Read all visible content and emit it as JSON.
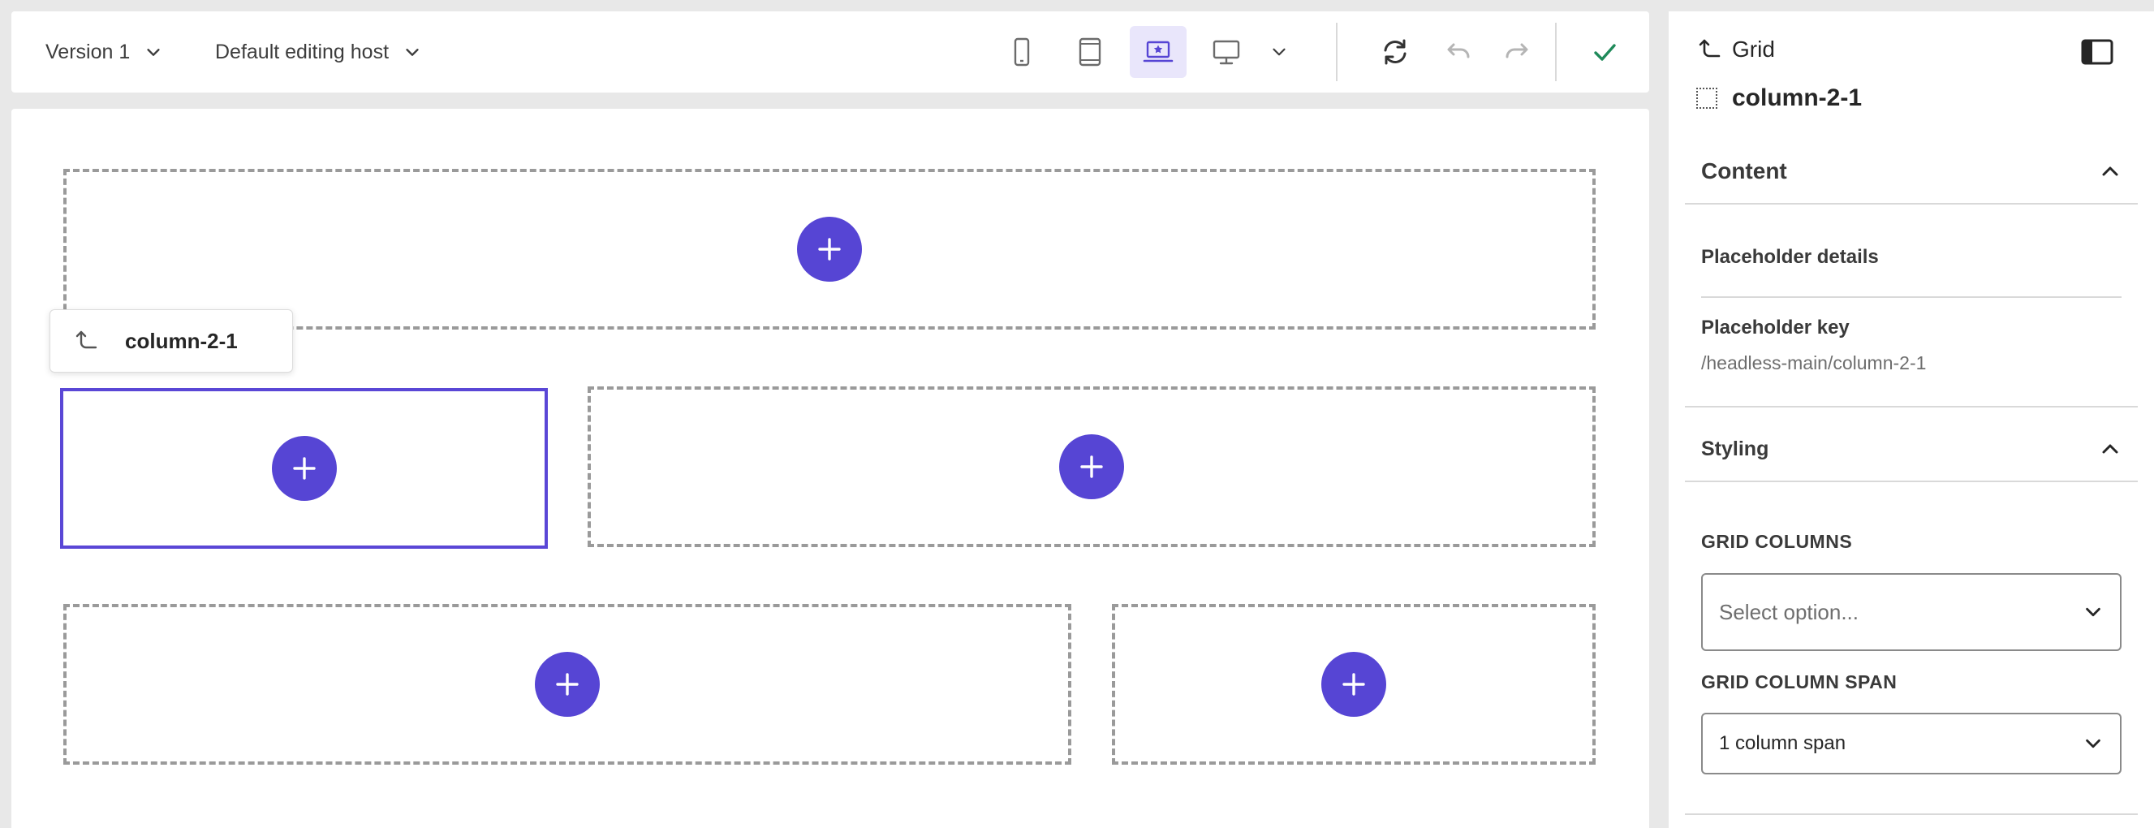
{
  "toolbar": {
    "version_label": "Version 1",
    "host_label": "Default editing host"
  },
  "canvas": {
    "chip_label": "column-2-1"
  },
  "panel": {
    "back_label": "Grid",
    "component_name": "column-2-1",
    "content_section": "Content",
    "placeholder_details": "Placeholder details",
    "placeholder_key_label": "Placeholder key",
    "placeholder_key_value": "/headless-main/column-2-1",
    "styling_section": "Styling",
    "grid_columns_label": "GRID COLUMNS",
    "grid_columns_placeholder": "Select option...",
    "grid_column_span_label": "GRID COLUMN SPAN",
    "grid_column_span_value": "1 column span"
  },
  "colors": {
    "accent": "#5645d4",
    "accent_light": "#e9e6fb",
    "confirm": "#1f8a5a"
  },
  "icons": [
    "chevron-down-icon",
    "phone-icon",
    "tablet-icon",
    "laptop-star-icon",
    "desktop-icon",
    "refresh-icon",
    "undo-icon",
    "redo-icon",
    "check-icon",
    "parent-arrow-icon",
    "panel-toggle-icon",
    "chevron-up-icon",
    "plus-icon",
    "dotted-square-icon"
  ]
}
